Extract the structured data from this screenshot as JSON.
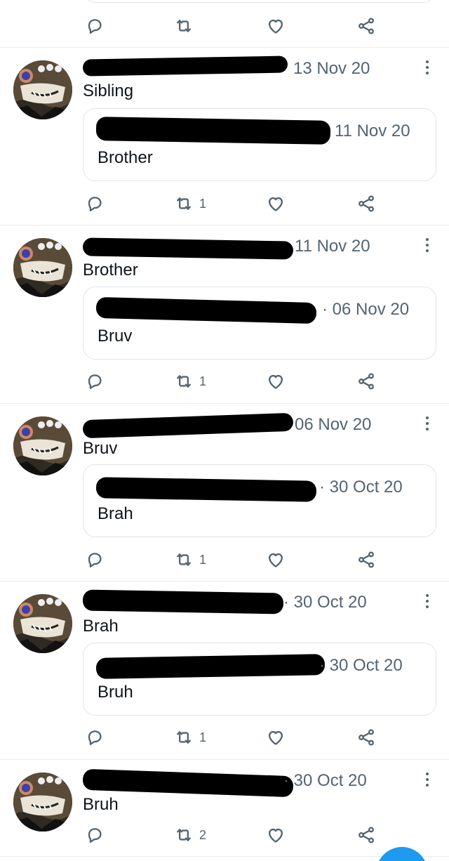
{
  "tweets": [
    {
      "date": "13 Nov 20",
      "text": "Sibling",
      "quote": {
        "date": "11 Nov 20",
        "text": "Brother"
      },
      "retweets": "1"
    },
    {
      "date": "11 Nov 20",
      "text": "Brother",
      "quote": {
        "date": "· 06 Nov 20",
        "text": "Bruv"
      },
      "retweets": "1"
    },
    {
      "date": "06 Nov 20",
      "text": "Bruv",
      "quote": {
        "date": "· 30 Oct 20",
        "text": "Brah"
      },
      "retweets": "1"
    },
    {
      "date": "· 30 Oct 20",
      "text": "Brah",
      "quote": {
        "date": "· 30 Oct 20",
        "text": "Bruh"
      },
      "retweets": "1"
    },
    {
      "date": "· 30 Oct 20",
      "text": "Bruh",
      "retweets": "2"
    }
  ],
  "icons": {
    "reply": "reply-icon",
    "retweet": "retweet-icon",
    "like": "heart-icon",
    "share": "share-icon",
    "more": "more-icon"
  },
  "colors": {
    "accent": "#1d9bf0",
    "muted": "#536471",
    "text": "#0f1419",
    "border": "#e6ecf0"
  }
}
